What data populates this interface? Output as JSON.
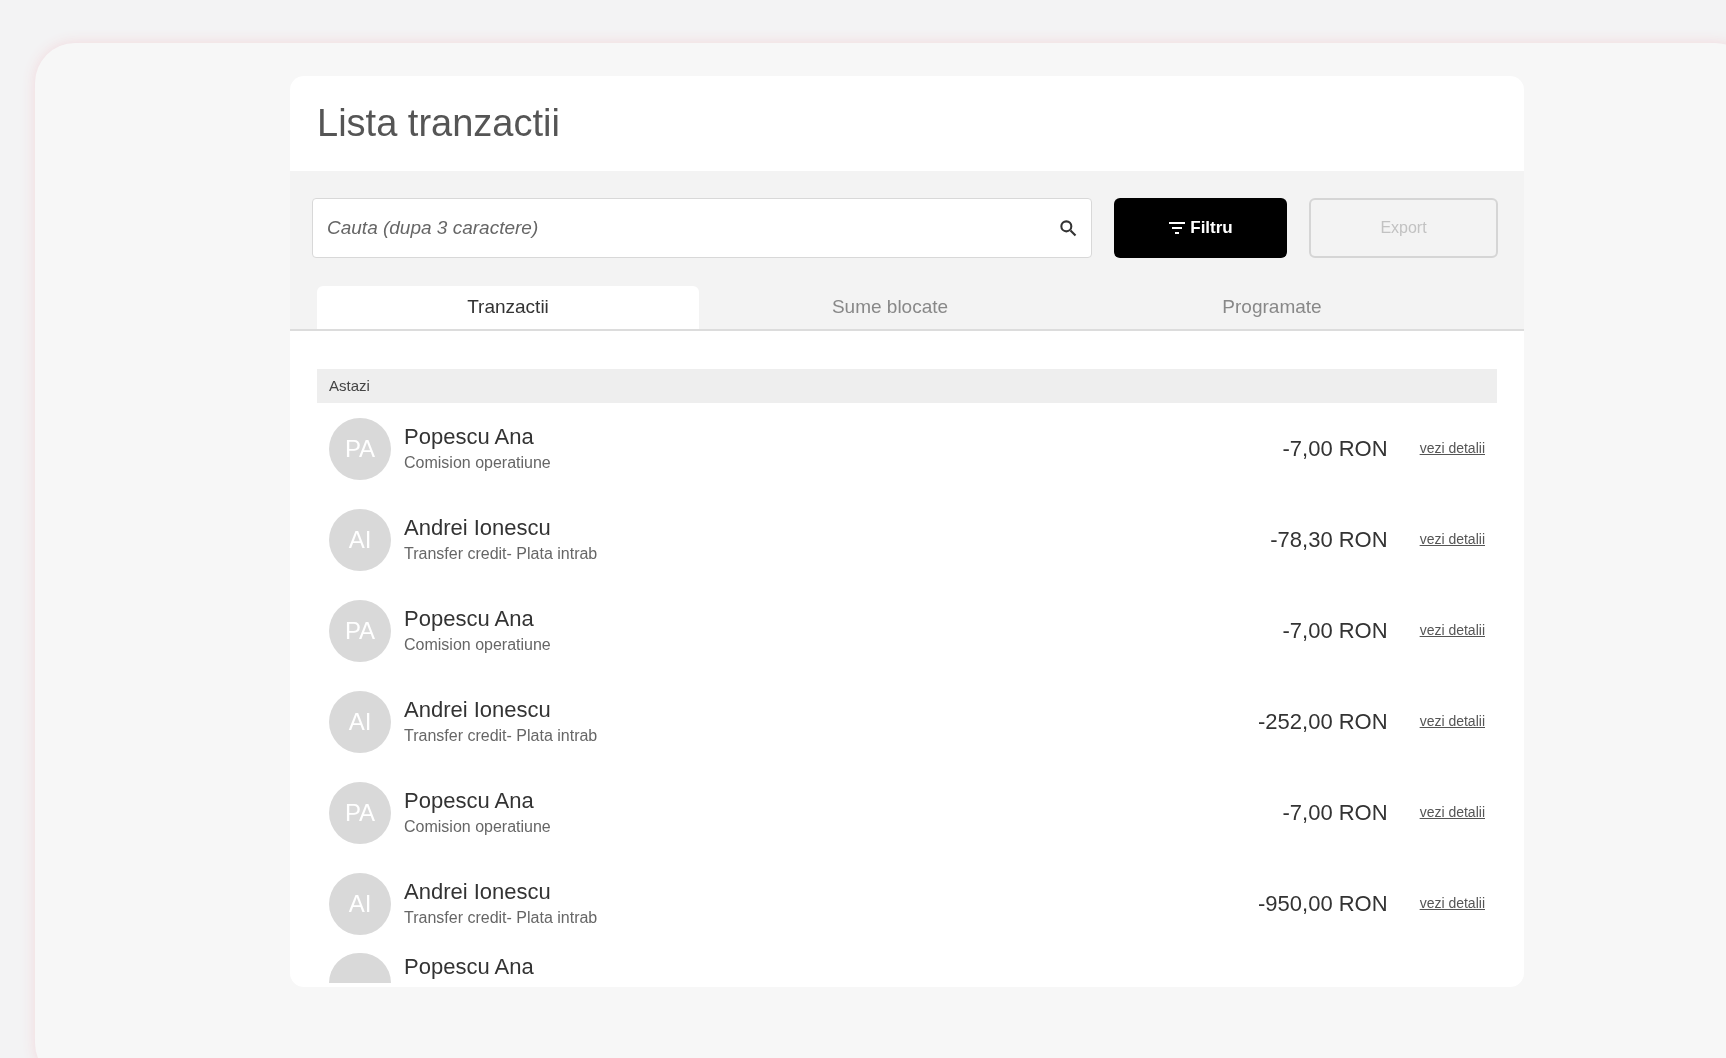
{
  "title": "Lista tranzactii",
  "search": {
    "placeholder": "Cauta (dupa 3 caractere)"
  },
  "buttons": [
    {
      "label": "Filtru",
      "kind": "filter",
      "disabled": false
    },
    {
      "label": "Export",
      "kind": "outline",
      "disabled": true
    }
  ],
  "tabs": [
    {
      "label": "Tranzactii",
      "selected": true
    },
    {
      "label": "Sume blocate",
      "selected": false
    },
    {
      "label": "Programate",
      "selected": false
    }
  ],
  "group": "Astazi",
  "transactions": [
    {
      "initials": "PA",
      "name": "Popescu Ana",
      "description": "Comision operatiune",
      "amount": "-7,00 RON",
      "link": "vezi detalii"
    },
    {
      "initials": "AI",
      "name": "Andrei Ionescu",
      "description": "Transfer credit- Plata intrab",
      "amount": "-78,30 RON",
      "link": "vezi detalii"
    },
    {
      "initials": "PA",
      "name": "Popescu Ana",
      "description": "Comision operatiune",
      "amount": "-7,00 RON",
      "link": "vezi detalii"
    },
    {
      "initials": "AI",
      "name": "Andrei Ionescu",
      "description": "Transfer credit- Plata intrab",
      "amount": "-252,00 RON",
      "link": "vezi detalii"
    },
    {
      "initials": "PA",
      "name": "Popescu Ana",
      "description": "Comision operatiune",
      "amount": "-7,00 RON",
      "link": "vezi detalii"
    },
    {
      "initials": "AI",
      "name": "Andrei Ionescu",
      "description": "Transfer credit- Plata intrab",
      "amount": "-950,00 RON",
      "link": "vezi detalii"
    },
    {
      "name": "Popescu Ana"
    }
  ]
}
